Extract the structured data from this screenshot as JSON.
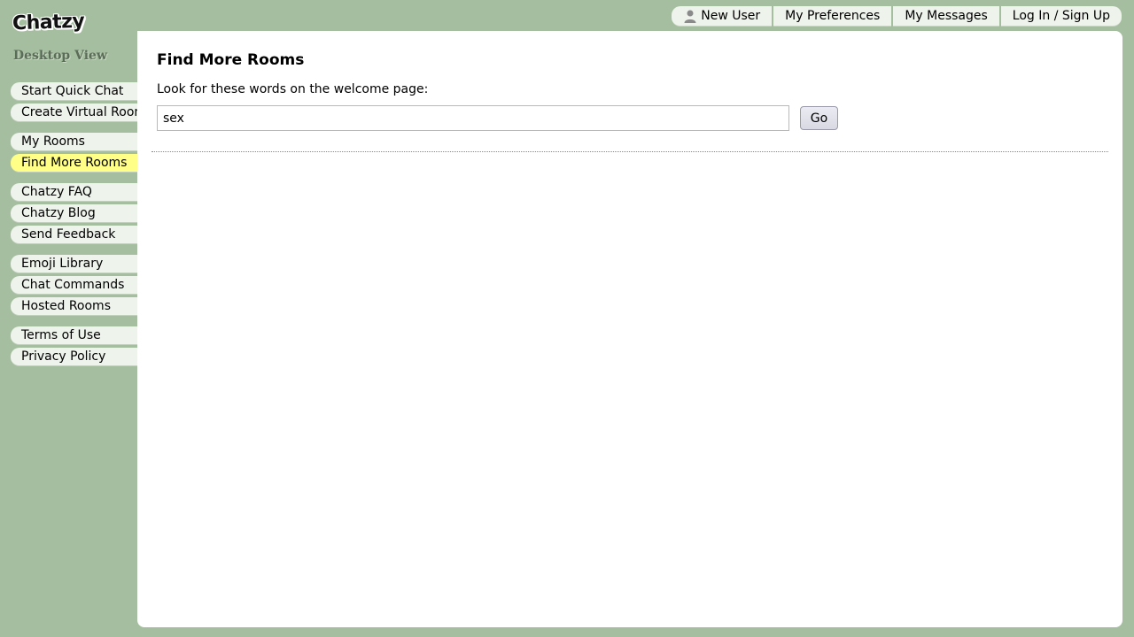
{
  "logo": {
    "text": "Chatzy"
  },
  "view_label": "Desktop View",
  "topnav": {
    "new_user": "New User",
    "preferences": "My Preferences",
    "messages": "My Messages",
    "login": "Log In / Sign Up"
  },
  "sidebar": {
    "groups": [
      [
        "Start Quick Chat",
        "Create Virtual Room"
      ],
      [
        "My Rooms",
        "Find More Rooms"
      ],
      [
        "Chatzy FAQ",
        "Chatzy Blog",
        "Send Feedback"
      ],
      [
        "Emoji Library",
        "Chat Commands",
        "Hosted Rooms"
      ],
      [
        "Terms of Use",
        "Privacy Policy"
      ]
    ],
    "active": "Find More Rooms"
  },
  "main": {
    "title": "Find More Rooms",
    "search_label": "Look for these words on the welcome page:",
    "search_value": "sex",
    "go_label": "Go"
  },
  "colors": {
    "background": "#a6bea0",
    "nav_item": "#eef3ec",
    "active_item": "#ffff88"
  },
  "icons": {
    "user": "user-icon",
    "collapse": "collapse-arrow-icon"
  }
}
